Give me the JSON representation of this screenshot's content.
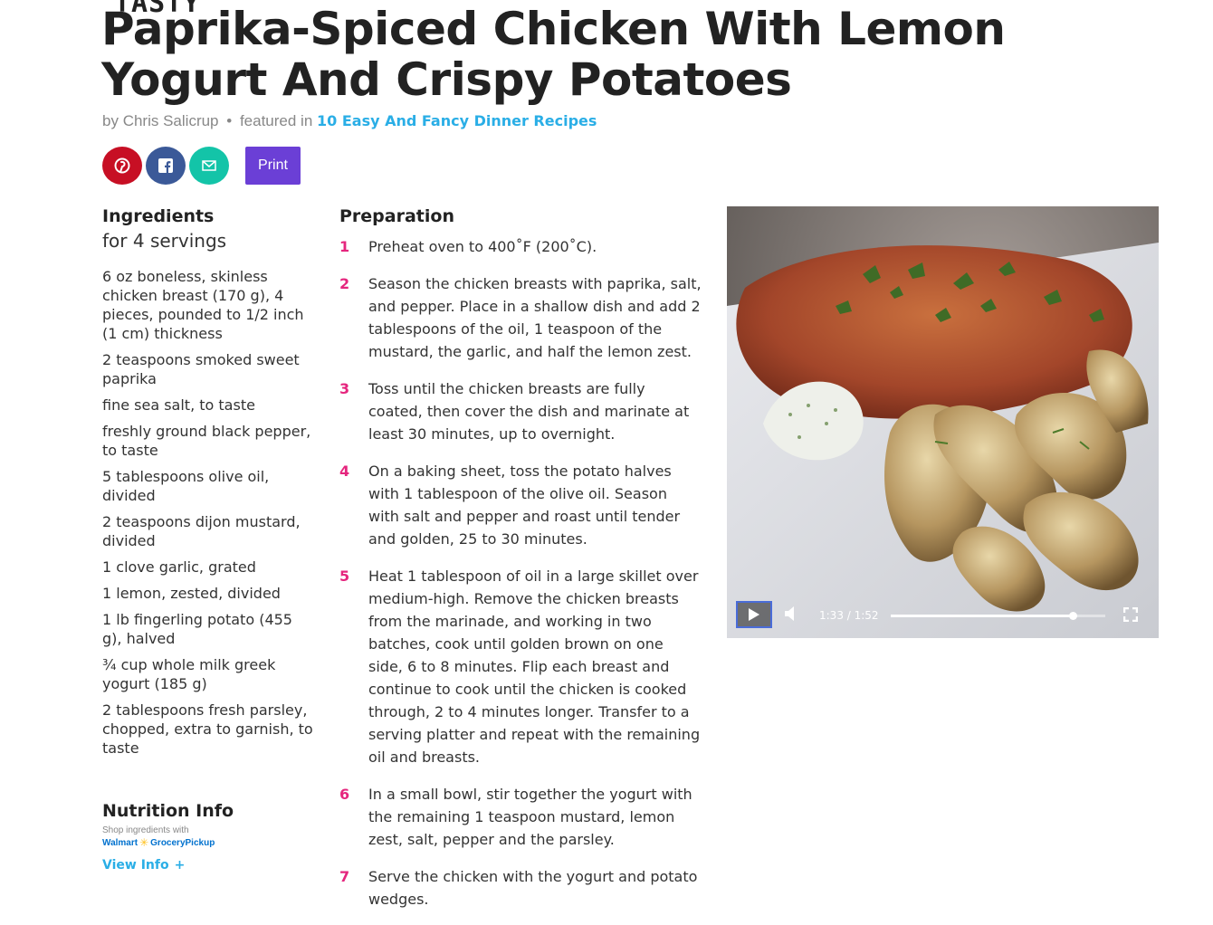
{
  "stray_text": "TASTY",
  "recipe": {
    "title": "Paprika-Spiced Chicken With Lemon Yogurt And Crispy Potatoes",
    "by_prefix": "by",
    "author": "Chris Salicrup",
    "dot": "•",
    "featured_prefix": "featured in",
    "featured_link": "10 Easy And Fancy Dinner Recipes"
  },
  "share": {
    "pinterest_icon": "pinterest-icon",
    "facebook_icon": "facebook-icon",
    "email_icon": "mail-icon",
    "print_label": "Print"
  },
  "ingredients": {
    "heading": "Ingredients",
    "servings": "for 4 servings",
    "items": [
      "6 oz boneless, skinless chicken breast (170 g), 4 pieces, pounded to 1/2 inch (1 cm) thickness",
      "2 teaspoons smoked sweet paprika",
      "fine sea salt, to taste",
      "freshly ground black pepper, to taste",
      "5 tablespoons olive oil, divided",
      "2 teaspoons dijon mustard, divided",
      "1 clove garlic, grated",
      "1 lemon, zested, divided",
      "1 lb fingerling potato (455 g), halved",
      "¾ cup whole milk greek yogurt (185 g)",
      "2 tablespoons fresh parsley, chopped, extra to garnish, to taste"
    ]
  },
  "nutrition": {
    "heading": "Nutrition Info",
    "shop_text": "Shop ingredients with",
    "walmart": "Walmart",
    "grocery": "GroceryPickup",
    "view_label": "View Info",
    "plus": "+"
  },
  "preparation": {
    "heading": "Preparation",
    "steps": [
      {
        "num": "1",
        "text": "Preheat oven to 400˚F (200˚C)."
      },
      {
        "num": "2",
        "text": "Season the chicken breasts with paprika, salt, and pepper. Place in a shallow dish and add 2 tablespoons of the oil, 1 teaspoon of the mustard, the garlic, and half the lemon zest."
      },
      {
        "num": "3",
        "text": "Toss until the chicken breasts are fully coated, then cover the dish and marinate at least 30 minutes, up to overnight."
      },
      {
        "num": "4",
        "text": "On a baking sheet, toss the potato halves with 1 tablespoon of the olive oil. Season with salt and pepper and roast until tender and golden, 25 to 30 minutes."
      },
      {
        "num": "5",
        "text": "Heat 1 tablespoon of oil in a large skillet over medium-high. Remove the chicken breasts from the marinade, and working in two batches, cook until golden brown on one side, 6 to 8 minutes. Flip each breast and continue to cook until the chicken is cooked through, 2 to 4 minutes longer. Transfer to a serving platter and repeat with the remaining oil and breasts."
      },
      {
        "num": "6",
        "text": "In a small bowl, stir together the yogurt with the remaining 1 teaspoon mustard, lemon zest, salt, pepper and the parsley."
      },
      {
        "num": "7",
        "text": "Serve the chicken with the yogurt and potato wedges."
      }
    ]
  },
  "video": {
    "time": "1:33 / 1:52",
    "progress": 0.85,
    "play_icon": "play-icon",
    "volume_icon": "volume-icon",
    "fullscreen_icon": "fullscreen-icon"
  }
}
